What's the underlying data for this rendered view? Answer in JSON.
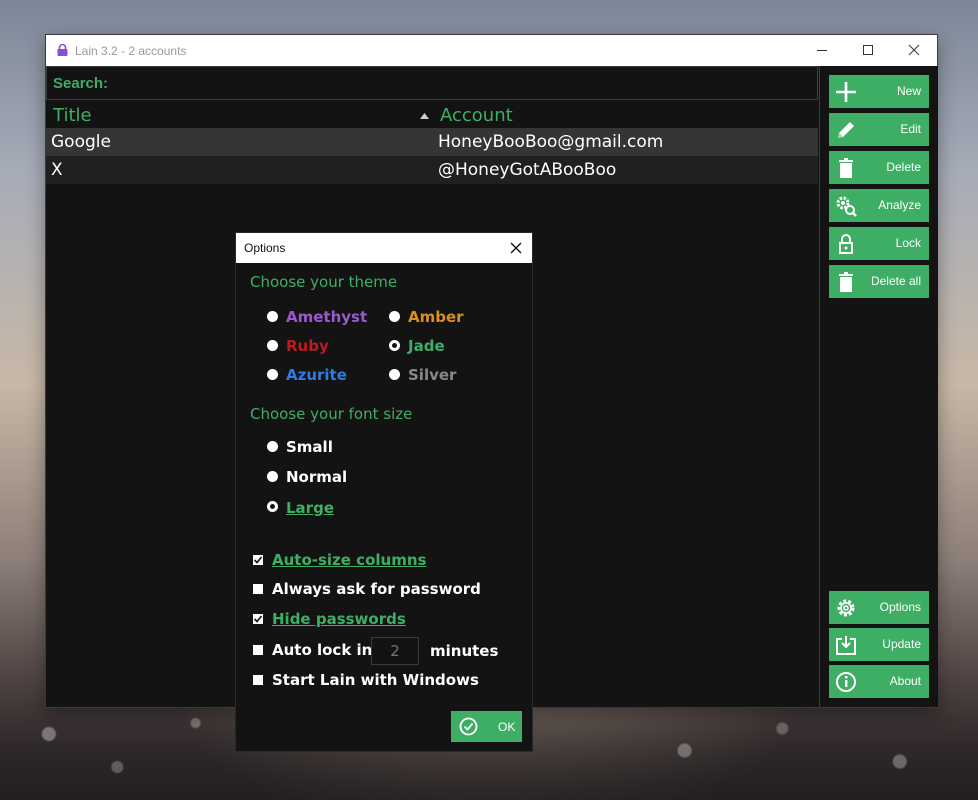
{
  "window": {
    "title": "Lain 3.2 - 2 accounts"
  },
  "search": {
    "label": "Search:",
    "value": ""
  },
  "table": {
    "columns": [
      "Title",
      "Account"
    ],
    "sort_indicator": "ascending",
    "rows": [
      {
        "title": "Google",
        "account": "HoneyBooBoo@gmail.com"
      },
      {
        "title": "X",
        "account": "@HoneyGotABooBoo"
      }
    ]
  },
  "sidebar": {
    "top": [
      {
        "label": "New",
        "icon": "plus-icon"
      },
      {
        "label": "Edit",
        "icon": "pencil-icon"
      },
      {
        "label": "Delete",
        "icon": "trash-icon"
      },
      {
        "label": "Analyze",
        "icon": "gear-search-icon"
      },
      {
        "label": "Lock",
        "icon": "padlock-icon"
      },
      {
        "label": "Delete all",
        "icon": "trash-icon"
      }
    ],
    "bottom": [
      {
        "label": "Options",
        "icon": "gear-icon"
      },
      {
        "label": "Update",
        "icon": "download-icon"
      },
      {
        "label": "About",
        "icon": "info-icon"
      }
    ]
  },
  "options": {
    "title": "Options",
    "theme": {
      "label": "Choose your theme",
      "choices": [
        {
          "label": "Amethyst",
          "color": "#9b59d0"
        },
        {
          "label": "Amber",
          "color": "#d9901e"
        },
        {
          "label": "Ruby",
          "color": "#c0191e"
        },
        {
          "label": "Jade",
          "color": "#3fae65"
        },
        {
          "label": "Azurite",
          "color": "#2f7be0"
        },
        {
          "label": "Silver",
          "color": "#888888"
        }
      ],
      "selected": "Jade"
    },
    "font_size": {
      "label": "Choose your font size",
      "choices": [
        "Small",
        "Normal",
        "Large"
      ],
      "selected": "Large"
    },
    "checkboxes": {
      "auto_size": {
        "label": "Auto-size columns",
        "checked": true
      },
      "ask_password": {
        "label": "Always ask for password",
        "checked": false
      },
      "hide_passwords": {
        "label": "Hide passwords",
        "checked": true
      },
      "auto_lock": {
        "label": "Auto lock in",
        "checked": false,
        "minutes": "2",
        "suffix": "minutes"
      },
      "start_with_windows": {
        "label": "Start Lain with Windows",
        "checked": false
      }
    },
    "ok_label": "OK"
  },
  "colors": {
    "accent": "#3fae65",
    "background": "#131313"
  }
}
